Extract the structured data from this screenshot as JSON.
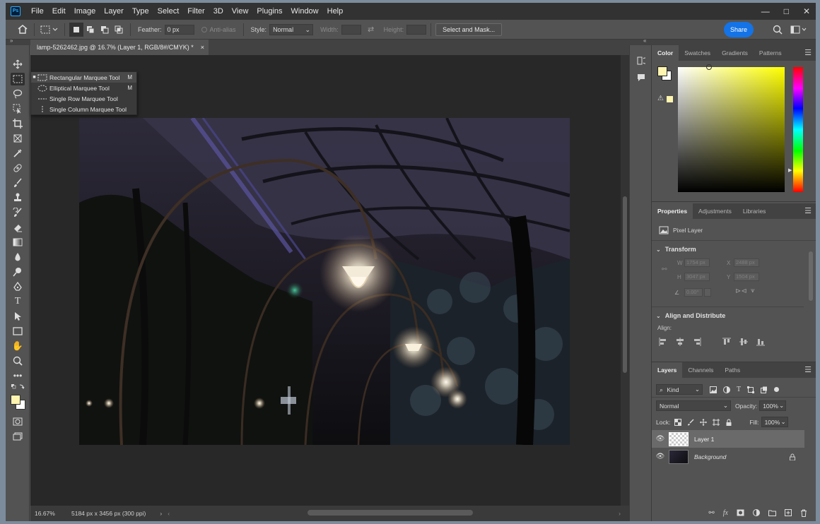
{
  "menu": {
    "logo": "Ps",
    "items": [
      "File",
      "Edit",
      "Image",
      "Layer",
      "Type",
      "Select",
      "Filter",
      "3D",
      "View",
      "Plugins",
      "Window",
      "Help"
    ],
    "window_controls": [
      "—",
      "□",
      "✕"
    ]
  },
  "options": {
    "feather_label": "Feather:",
    "feather_value": "0 px",
    "antialias_label": "Anti-alias",
    "style_label": "Style:",
    "style_value": "Normal",
    "width_label": "Width:",
    "height_label": "Height:",
    "select_mask_label": "Select and Mask...",
    "share_label": "Share"
  },
  "document": {
    "tab_title": "lamp-5262462.jpg @ 16.7% (Layer 1, RGB/8#/CMYK) *",
    "close": "×",
    "zoom": "16.67%",
    "info": "5184 px x 3456 px (300 ppi)"
  },
  "flyout": {
    "items": [
      {
        "label": "Rectangular Marquee Tool",
        "key": "M"
      },
      {
        "label": "Elliptical Marquee Tool",
        "key": "M"
      },
      {
        "label": "Single Row Marquee Tool",
        "key": ""
      },
      {
        "label": "Single Column Marquee Tool",
        "key": ""
      }
    ]
  },
  "colors": {
    "foreground": "#fff5b0",
    "background": "#ffffff",
    "picker_hue": "#ffff00"
  },
  "color_panel": {
    "tabs": [
      "Color",
      "Swatches",
      "Gradients",
      "Patterns"
    ]
  },
  "properties": {
    "tabs": [
      "Properties",
      "Adjustments",
      "Libraries"
    ],
    "kind": "Pixel Layer",
    "transform_title": "Transform",
    "w_label": "W",
    "w_value": "1754 px",
    "h_label": "H",
    "h_value": "3047 px",
    "x_label": "X",
    "x_value": "2488 px",
    "y_label": "Y",
    "y_value": "1504 px",
    "angle_value": "0.00°",
    "align_title": "Align and Distribute",
    "align_label": "Align:"
  },
  "layers": {
    "tabs": [
      "Layers",
      "Channels",
      "Paths"
    ],
    "kind_label": "Kind",
    "blend_mode": "Normal",
    "opacity_label": "Opacity:",
    "opacity_value": "100%",
    "lock_label": "Lock:",
    "fill_label": "Fill:",
    "fill_value": "100%",
    "items": [
      {
        "name": "Layer 1"
      },
      {
        "name": "Background"
      }
    ]
  }
}
